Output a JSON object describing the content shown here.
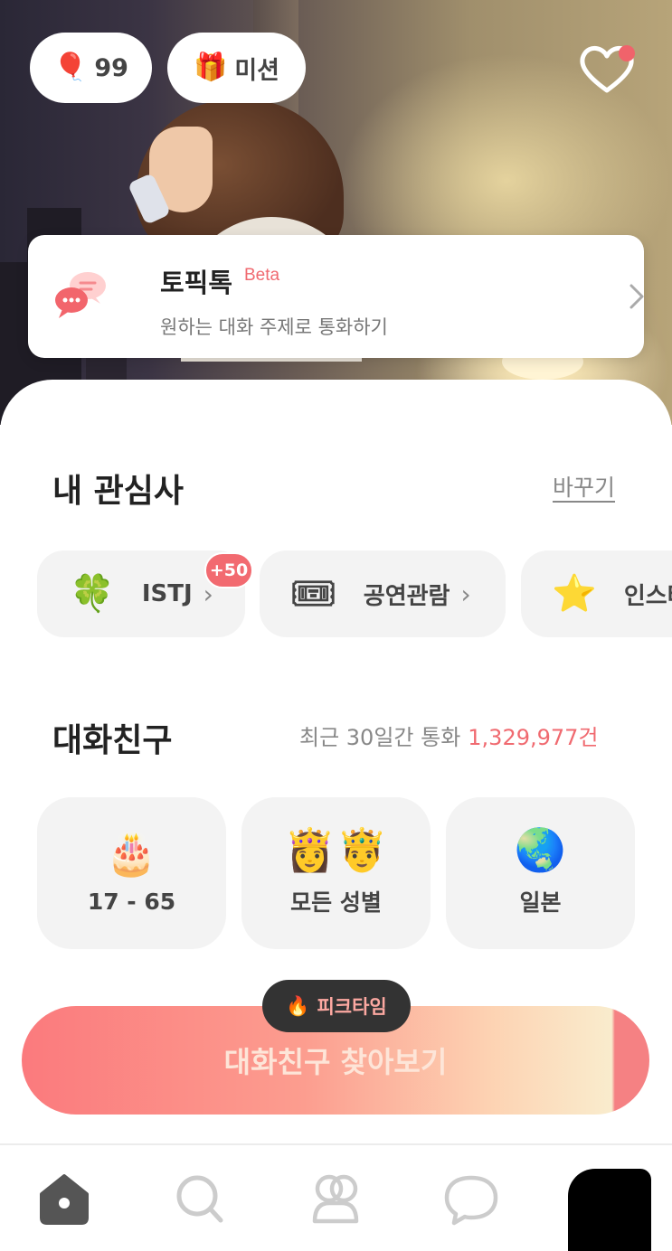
{
  "header": {
    "balloon": {
      "icon": "balloon-icon",
      "count": "99"
    },
    "mission": {
      "icon": "gift-icon",
      "label": "미션"
    },
    "heart": {
      "icon": "heart-notification-icon",
      "has_dot": true
    }
  },
  "topic_card": {
    "icon": "chat-bubbles-icon",
    "title": "토픽톡",
    "badge": "Beta",
    "subtitle": "원하는 대화 주제로 통화하기"
  },
  "interests": {
    "title": "내 관심사",
    "change_label": "바꾸기",
    "chips": [
      {
        "emoji": "🍀",
        "label": "ISTJ",
        "badge": "+50"
      },
      {
        "emoji": "🎟",
        "label": "공연관람"
      },
      {
        "emoji": "⭐",
        "label": "인스타"
      }
    ]
  },
  "friends": {
    "title": "대화친구",
    "stats_prefix": "최근 30일간 통화",
    "stats_count": "1,329,977건",
    "filters": [
      {
        "emoji": "🎂",
        "label": "17 - 65"
      },
      {
        "emoji": "👸🤴",
        "label": "모든 성별"
      },
      {
        "emoji": "🌏",
        "label": "일본"
      }
    ]
  },
  "cta": {
    "label": "대화친구 찾아보기",
    "peak_badge": "피크타임",
    "peak_icon": "fire-icon"
  },
  "nav": {
    "items": [
      "home-icon",
      "search-icon",
      "friends-icon",
      "chat-icon",
      "profile-icon"
    ],
    "active": "home-icon"
  },
  "colors": {
    "accent": "#f06a70",
    "cta_start": "#fb7a7d",
    "chip_bg": "#f3f3f3"
  }
}
